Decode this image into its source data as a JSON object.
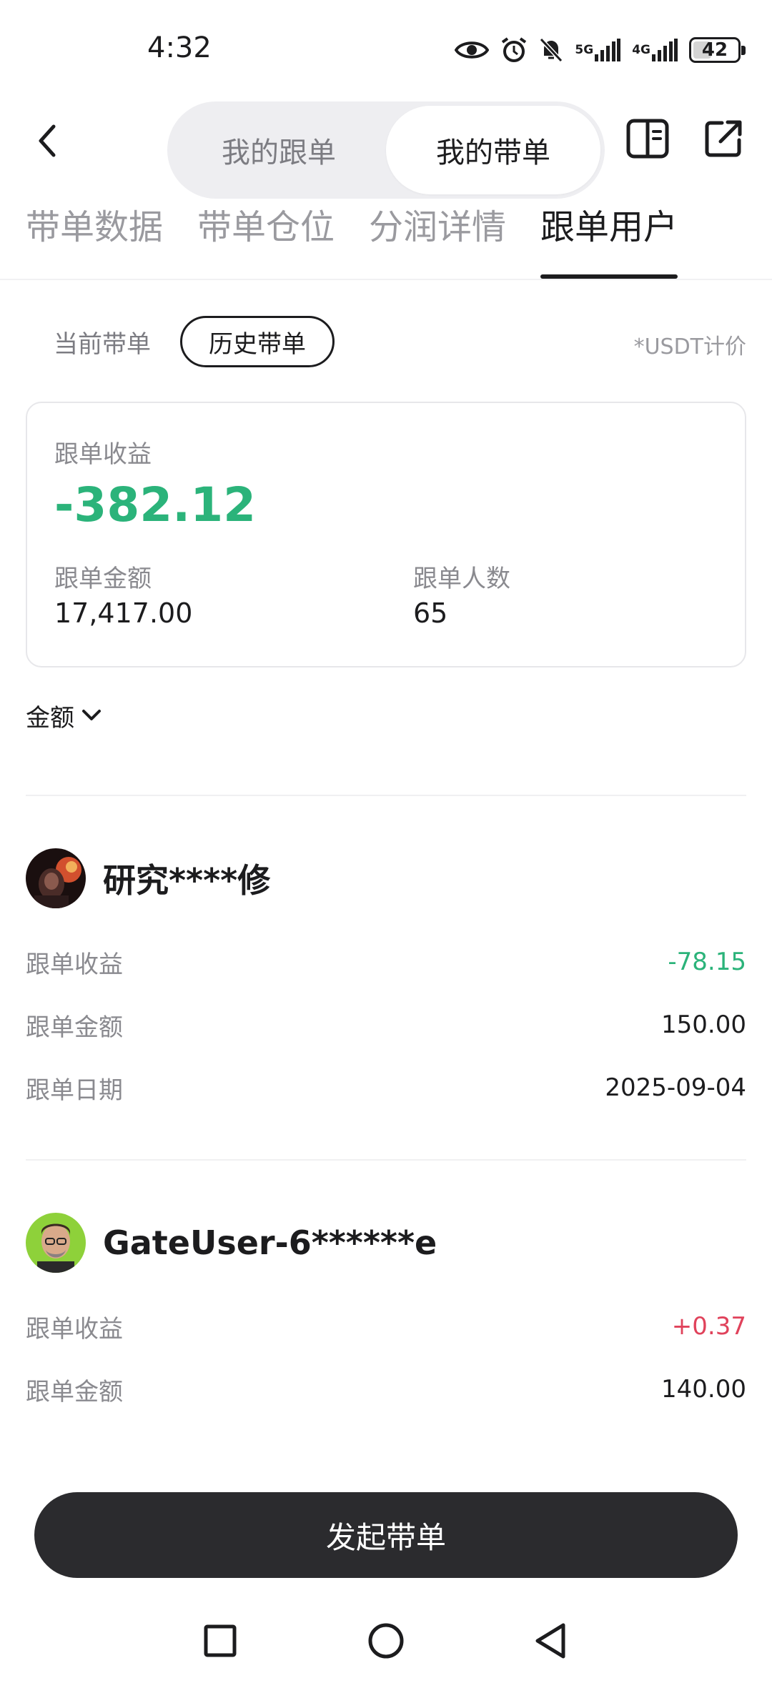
{
  "status_bar": {
    "time": "4:32",
    "net1": "5G",
    "net2": "4G",
    "battery": "42",
    "battery_level": 0.42,
    "icons": [
      "eye-icon",
      "alarm-icon",
      "mute-icon",
      "signal-icon",
      "signal-icon"
    ]
  },
  "header": {
    "segments": [
      "我的跟单",
      "我的带单"
    ],
    "active_segment": "我的带单",
    "icons": [
      "back-icon",
      "book-icon",
      "share-icon"
    ]
  },
  "tabs": [
    "带单数据",
    "带单仓位",
    "分润详情",
    "跟单用户"
  ],
  "active_tab": "跟单用户",
  "filters": {
    "current": "当前带单",
    "history": "历史带单",
    "note": "*USDT计价"
  },
  "summary": {
    "profit_label": "跟单收益",
    "profit_value": "-382.12",
    "amount_label": "跟单金额",
    "amount_value": "17,417.00",
    "count_label": "跟单人数",
    "count_value": "65"
  },
  "sort": {
    "label": "金额"
  },
  "users": [
    {
      "name": "研究****修",
      "rows": [
        {
          "label": "跟单收益",
          "value": "-78.15"
        },
        {
          "label": "跟单金额",
          "value": "150.00"
        },
        {
          "label": "跟单日期",
          "value": "2025-09-04"
        }
      ]
    },
    {
      "name": "GateUser-6******e",
      "rows": [
        {
          "label": "跟单收益",
          "value": "+0.37"
        },
        {
          "label": "跟单金额",
          "value": "140.00"
        }
      ]
    }
  ],
  "cta": "发起带单",
  "colors": {
    "negative": "#2bb37a",
    "positive": "#e0425b",
    "primary_dark": "#2b2b2e"
  }
}
